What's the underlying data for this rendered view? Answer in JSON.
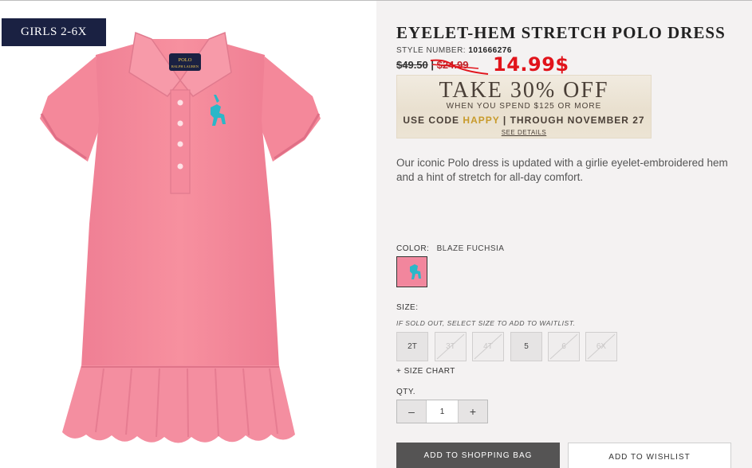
{
  "badge": {
    "label": "GIRLS 2-6X"
  },
  "product": {
    "title": "EYELET-HEM STRETCH POLO DRESS",
    "style_label": "STYLE NUMBER:",
    "style_number": "101666276",
    "original_price": "$49.50",
    "price_separator": "|",
    "sale_price": "$24.99",
    "handwritten_price": "14.99$",
    "description": "Our iconic Polo dress is updated with a girlie eyelet-embroidered hem and a hint of stretch for all-day comfort."
  },
  "promo": {
    "headline": "TAKE 30% OFF",
    "subline": "WHEN YOU SPEND $125 OR MORE",
    "code_prefix": "USE CODE",
    "code": "HAPPY",
    "code_suffix": "| THROUGH NOVEMBER 27",
    "details_link": "SEE DETAILS"
  },
  "color": {
    "label": "COLOR:",
    "value": "BLAZE FUCHSIA",
    "swatch_hex": "#f2869d"
  },
  "size": {
    "label": "SIZE:",
    "note": "IF SOLD OUT, SELECT SIZE TO ADD TO WAITLIST.",
    "options": [
      {
        "label": "2T",
        "available": true
      },
      {
        "label": "3T",
        "available": false
      },
      {
        "label": "4T",
        "available": false
      },
      {
        "label": "5",
        "available": true
      },
      {
        "label": "6",
        "available": false
      },
      {
        "label": "6X",
        "available": false
      }
    ],
    "chart_link": "+ SIZE CHART"
  },
  "quantity": {
    "label": "QTY.",
    "value": "1",
    "decrement": "–",
    "increment": "+"
  },
  "actions": {
    "add_to_bag": "ADD TO SHOPPING BAG",
    "add_to_wishlist": "ADD TO WISHLIST"
  },
  "logo": {
    "line1": "POLO",
    "line2": "RALPH LAUREN"
  },
  "colors": {
    "dress_pink": "#f6889c",
    "badge_navy": "#1a2142",
    "sale_red": "#c0252a",
    "handwritten_red": "#e1141b",
    "pony_turquoise": "#2bb7c8"
  }
}
